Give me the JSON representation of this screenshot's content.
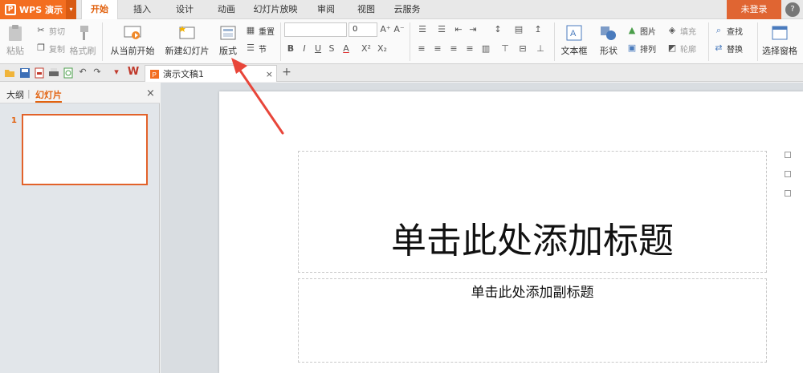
{
  "app": {
    "name": "WPS 演示",
    "dropdown_glyph": "▾"
  },
  "tabs": [
    "开始",
    "插入",
    "设计",
    "动画",
    "幻灯片放映",
    "审阅",
    "视图",
    "云服务"
  ],
  "login_label": "未登录",
  "window_controls": [
    "?",
    "−",
    "×"
  ],
  "ribbon": {
    "paste": "粘贴",
    "cut": "剪切",
    "copy": "复制",
    "format_painter": "格式刷",
    "from_current": "从当前开始",
    "new_slide": "新建幻灯片",
    "layout": "版式",
    "reset": "重置",
    "section": "节",
    "font_size_value": "0",
    "text_box": "文本框",
    "shape": "形状",
    "picture": "图片",
    "fill": "填充",
    "arrange": "排列",
    "outline": "轮廓",
    "find": "查找",
    "replace": "替换",
    "selection_pane": "选择窗格",
    "font_styles": [
      "B",
      "I",
      "U",
      "S",
      "A",
      "X²",
      "X₂"
    ],
    "grow_font": "A⁺",
    "shrink_font": "A⁻"
  },
  "doc_tab": {
    "title": "演示文稿1",
    "close": "×",
    "new_tab": "+"
  },
  "left_panel": {
    "tab_outline": "大纲",
    "tab_slides": "幻灯片",
    "close": "×",
    "slide_number": "1"
  },
  "slide": {
    "title_placeholder": "单击此处添加标题",
    "subtitle_placeholder": "单击此处添加副标题"
  },
  "colors": {
    "accent": "#f36e20",
    "active_tab_text": "#e2620f",
    "annotation_arrow": "#e8463a"
  }
}
